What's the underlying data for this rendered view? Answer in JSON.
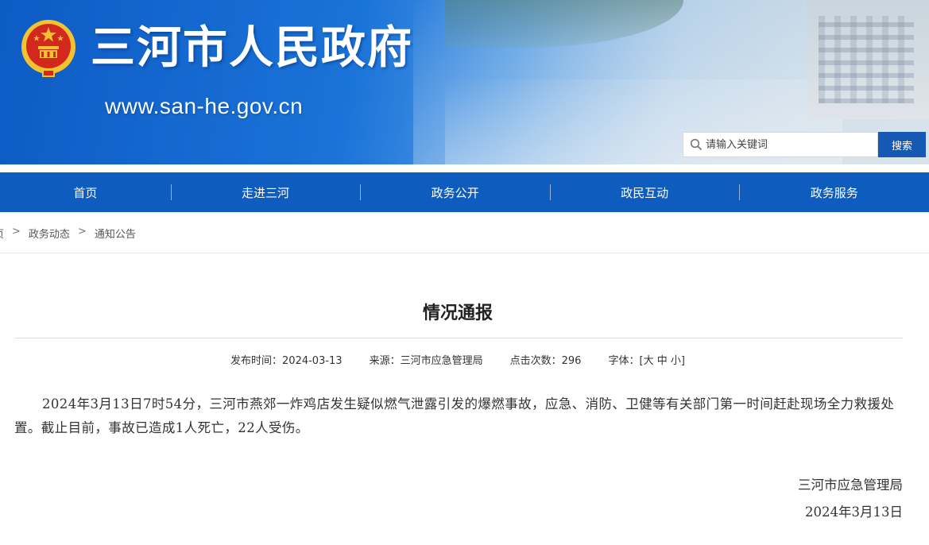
{
  "header": {
    "site_title": "三河市人民政府",
    "site_url": "www.san-he.gov.cn",
    "search_placeholder": "请输入关键词",
    "search_button": "搜索",
    "colors": {
      "banner_blue": "#1a73d8",
      "nav_blue": "#0f5cbf",
      "search_button": "#1559b5",
      "emblem_red": "#d2281e",
      "emblem_gold": "#f2c230"
    }
  },
  "nav": {
    "items": [
      {
        "label": "首页"
      },
      {
        "label": "走进三河"
      },
      {
        "label": "政务公开"
      },
      {
        "label": "政民互动"
      },
      {
        "label": "政务服务"
      }
    ]
  },
  "breadcrumb": {
    "items": [
      "页",
      "政务动态",
      "通知公告"
    ],
    "separator": ">"
  },
  "article": {
    "title": "情况通报",
    "meta": {
      "publish_label": "发布时间：",
      "publish_date": "2024-03-13",
      "source_label": "来源：",
      "source": "三河市应急管理局",
      "views_label": "点击次数：",
      "views": "296",
      "fontsize_label": "字体：",
      "fontsize_open": "[",
      "fontsize_large": "大",
      "fontsize_medium": "中",
      "fontsize_small": "小",
      "fontsize_close": "]"
    },
    "body": "2024年3月13日7时54分，三河市燕郊一炸鸡店发生疑似燃气泄露引发的爆燃事故，应急、消防、卫健等有关部门第一时间赶赴现场全力救援处置。截止目前，事故已造成1人死亡，22人受伤。",
    "signature_org": "三河市应急管理局",
    "signature_date": "2024年3月13日"
  },
  "icons": {
    "emblem": "national-emblem-icon",
    "search": "magnifier-icon"
  }
}
